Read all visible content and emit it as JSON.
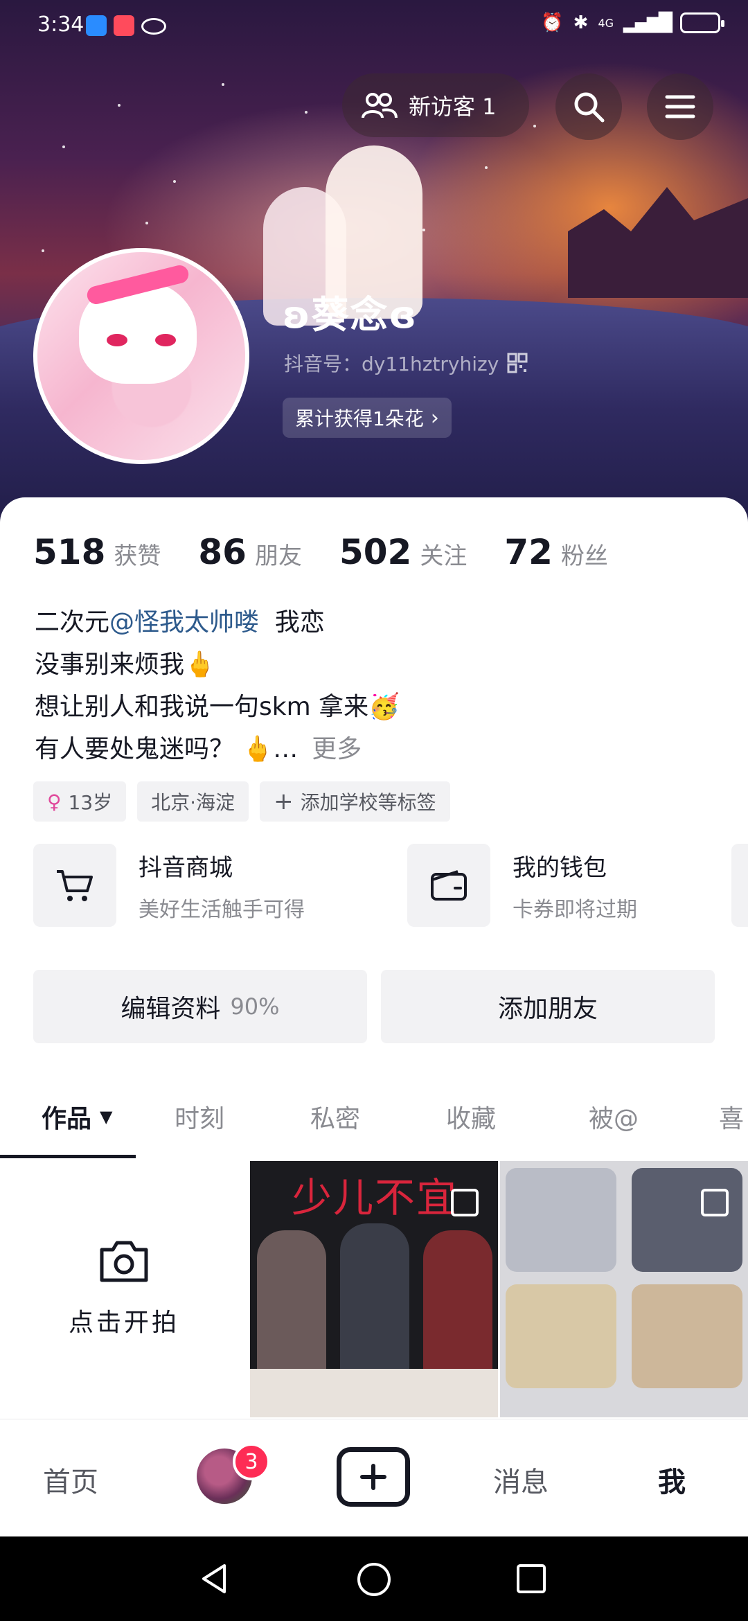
{
  "status_bar": {
    "time": "3:34",
    "network": "4G"
  },
  "header": {
    "visitor_label": "新访客 1",
    "nickname": "ʚ葵念ɞ",
    "douyin_id": "抖音号：dy11hztryhizy",
    "flowers": "累计获得1朵花"
  },
  "stats": [
    {
      "num": "518",
      "label": "获赞"
    },
    {
      "num": "86",
      "label": "朋友"
    },
    {
      "num": "502",
      "label": "关注"
    },
    {
      "num": "72",
      "label": "粉丝"
    }
  ],
  "bio": {
    "line1_prefix": "二次元",
    "line1_mention": "@怪我太帅喽",
    "line1_suffix": "  我恋",
    "line2": "没事别来烦我🖕",
    "line3": "想让别人和我说一句skm 拿来🥳",
    "line4": "有人要处鬼迷吗？ 🖕…",
    "more": "更多"
  },
  "tags": {
    "age": "13岁",
    "location": "北京·海淀",
    "add_school": "添加学校等标签"
  },
  "services": [
    {
      "title": "抖音商城",
      "subtitle": "美好生活触手可得"
    },
    {
      "title": "我的钱包",
      "subtitle": "卡券即将过期"
    }
  ],
  "buttons": {
    "edit_profile": "编辑资料",
    "edit_percent": "90%",
    "add_friend": "添加朋友"
  },
  "tabs": [
    "作品",
    "时刻",
    "私密",
    "收藏",
    "被@",
    "喜"
  ],
  "grid": {
    "shoot_label": "点击开拍",
    "cover1_title": "少儿不宜"
  },
  "bottom_nav": {
    "home": "首页",
    "friends_badge": "3",
    "messages": "消息",
    "me": "我"
  },
  "colors": {
    "accent": "#fe2c55",
    "mention": "#2d5a8c",
    "text": "#161823",
    "muted": "#8a8b91"
  }
}
